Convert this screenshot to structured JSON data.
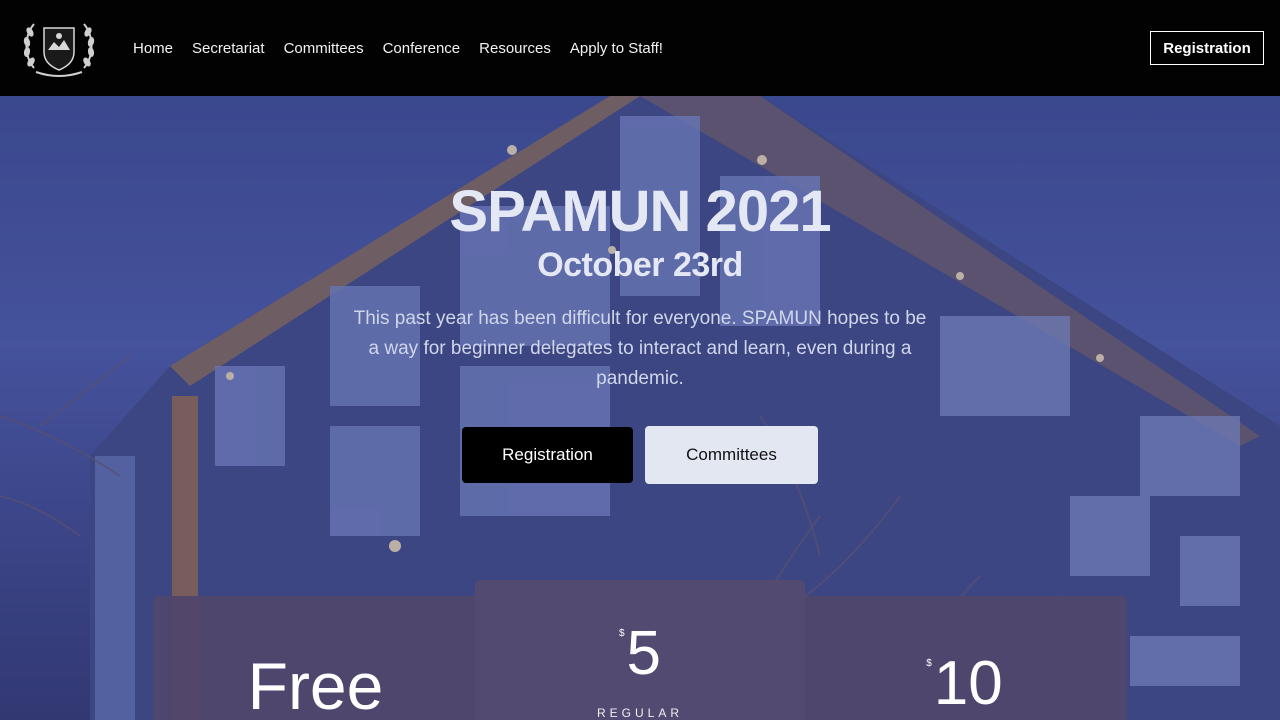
{
  "nav": {
    "logo": "spamun-crest-logo",
    "links": [
      "Home",
      "Secretariat",
      "Committees",
      "Conference",
      "Resources",
      "Apply to Staff!"
    ],
    "registration": "Registration"
  },
  "hero": {
    "title": "SPAMUN 2021",
    "date": "October 23rd",
    "description": "This past year has been difficult for everyone. SPAMUN hopes to be a way for beginner delegates to interact and learn, even during a pandemic.",
    "primary_button": "Registration",
    "secondary_button": "Committees"
  },
  "pricing": {
    "left": {
      "price": "Free"
    },
    "middle": {
      "currency": "$",
      "price": "5",
      "tier": "REGULAR"
    },
    "right": {
      "currency": "$",
      "price": "10"
    }
  },
  "colors": {
    "nav_bg": "#020202",
    "hero_tint": "#4a5aa0",
    "card_bg": "#50466c",
    "secondary_button_bg": "#e2e7f2"
  }
}
